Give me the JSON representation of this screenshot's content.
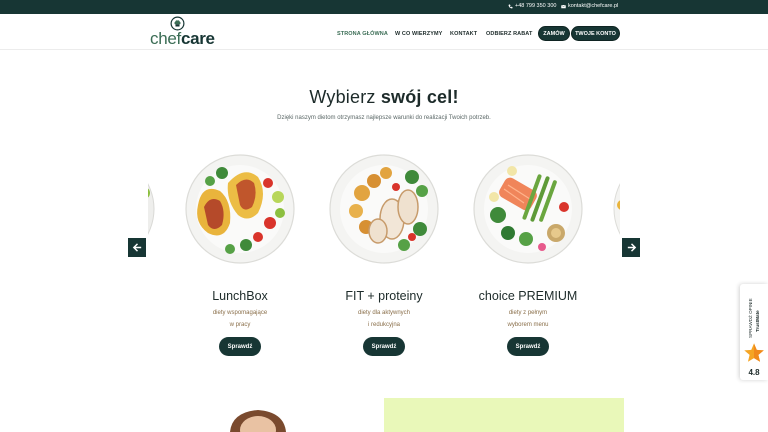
{
  "topbar": {
    "phone": "+48 799 350 300",
    "email": "kontakt@chefcare.pl",
    "phone_icon": "phone-icon",
    "email_icon": "mail-icon"
  },
  "header": {
    "logo": {
      "part1": "chef",
      "part2": "care",
      "icon": "chef-hat-icon"
    },
    "nav": [
      {
        "label": "STRONA GŁÓWNA",
        "active": true
      },
      {
        "label": "W CO WIERZYMY",
        "active": false
      },
      {
        "label": "KONTAKT",
        "active": false
      },
      {
        "label": "ODBIERZ RABAT",
        "active": false
      }
    ],
    "order_button": "ZAMÓW",
    "account_button": "TWOJE KONTO"
  },
  "hero": {
    "title_part1": "Wybierz",
    "title_part2": "swój cel!",
    "subtitle": "Dzięki naszym dietom otrzymasz najlepsze warunki do realizacji Twoich potrzeb."
  },
  "carousel": {
    "prev_icon": "arrow-left-icon",
    "next_icon": "arrow-right-icon",
    "cards": [
      {
        "title": "LunchBox",
        "desc_line1": "diety wspomagające",
        "desc_line2": "w pracy",
        "button": "Sprawdź",
        "image": "tacos-plate"
      },
      {
        "title": "FIT + proteiny",
        "desc_line1": "diety dla aktywnych",
        "desc_line2": "i redukcyjna",
        "button": "Sprawdź",
        "image": "chicken-potatoes-plate"
      },
      {
        "title": "choice PREMIUM",
        "desc_line1": "diety z pełnym",
        "desc_line2": "wyborem menu",
        "button": "Sprawdź",
        "image": "salmon-salad-plate"
      }
    ]
  },
  "trust_badge": {
    "label": "SPRAWDŹ OPINIE",
    "brand": "TrustMate",
    "rating": "4.8",
    "icon": "star-icon"
  },
  "colors": {
    "primary": "#173634",
    "accent_green": "#3b6d55",
    "lime": "#e9f8b9",
    "star": "#f5a524"
  }
}
